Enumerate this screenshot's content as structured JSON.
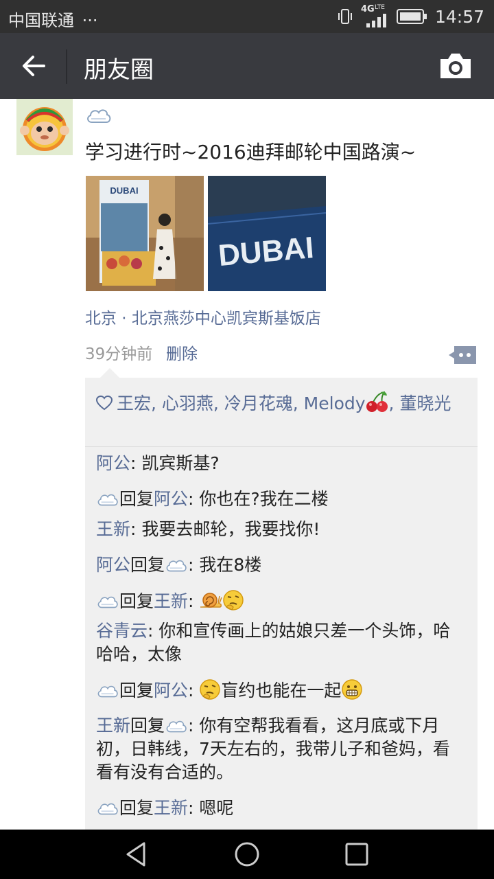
{
  "status": {
    "carrier": "中国联通",
    "dots": "···",
    "network": "4G",
    "lte": "LTE",
    "time": "14:57"
  },
  "header": {
    "title": "朋友圈"
  },
  "post": {
    "text": "学习进行时~2016迪拜邮轮中国路演~",
    "location": "北京 · 北京燕莎中心凯宾斯基饭店",
    "time": "39分钟前",
    "delete_label": "删除",
    "photo1_sign": "DUBAI",
    "photo2_sign": "DUBAI"
  },
  "likes": {
    "names_before": "王宏, 心羽燕, 冷月花魂, Melody",
    "names_after": ", 董晓光"
  },
  "comments": [
    {
      "name": "阿公",
      "sep": ": ",
      "text": "凯宾斯基?"
    },
    {
      "reply": "回复",
      "target": "阿公",
      "sep": ": ",
      "text": "你也在?我在二楼"
    },
    {
      "name": "王新",
      "sep": ": ",
      "text": "我要去邮轮，我要找你!"
    },
    {
      "name": "阿公",
      "reply": "回复",
      "sep": ": ",
      "text": "我在8楼"
    },
    {
      "reply": "回复",
      "target": "王新",
      "sep": ": "
    },
    {
      "name": "谷青云",
      "sep": ": ",
      "text": "你和宣传画上的姑娘只差一个头饰，哈哈哈，太像"
    },
    {
      "reply": "回复",
      "target": "阿公",
      "sep": ": ",
      "text": "盲约也能在一起"
    },
    {
      "name": "王新",
      "reply": "回复",
      "sep": ": ",
      "text": "你有空帮我看看，这月底或下月初，日韩线，7天左右的，我带儿子和爸妈，看看有没有合适的。"
    },
    {
      "reply": "回复",
      "target": "王新",
      "sep": ": ",
      "text": "嗯呢"
    }
  ],
  "icons": {
    "back": "arrow-left-icon",
    "camera": "camera-icon",
    "cloud": "cloud-icon",
    "like": "heart-icon",
    "more": "comment-more-icon"
  },
  "colors": {
    "link": "#576b95",
    "appbar": "#393a3f",
    "comment_bg": "#f0f0f0"
  }
}
